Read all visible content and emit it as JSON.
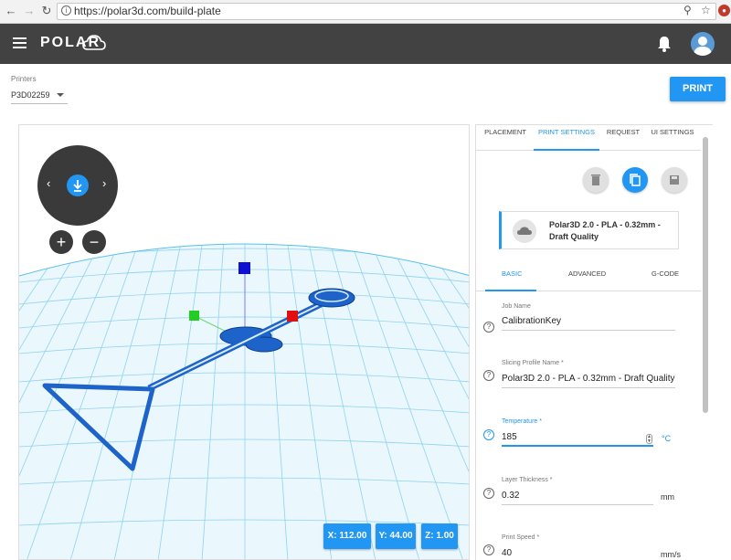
{
  "browser": {
    "url": "https://polar3d.com/build-plate",
    "back_icon": "arrow-left-icon",
    "forward_icon": "arrow-right-icon",
    "reload_icon": "reload-icon"
  },
  "header": {
    "logo_text": "POLAR",
    "bg_color": "#424242"
  },
  "printers": {
    "label": "Printers",
    "selected": "P3D02259"
  },
  "print_button": {
    "label": "PRINT",
    "color": "#2196f3"
  },
  "viewport": {
    "coords": {
      "x": "X: 112.00",
      "y": "Y: 44.00",
      "z": "Z: 1.00"
    },
    "zoom_in": "+",
    "zoom_out": "−"
  },
  "panel": {
    "tabs": [
      {
        "label": "PLACEMENT"
      },
      {
        "label": "PRINT SETTINGS"
      },
      {
        "label": "REQUEST"
      },
      {
        "label": "UI SETTINGS"
      }
    ],
    "profile_card": {
      "text": "Polar3D 2.0 - PLA - 0.32mm - Draft Quality"
    },
    "subtabs": [
      {
        "label": "BASIC"
      },
      {
        "label": "ADVANCED"
      },
      {
        "label": "G-CODE"
      }
    ],
    "fields": {
      "job_name": {
        "label": "Job Name",
        "value": "CalibrationKey"
      },
      "slicing_profile": {
        "label": "Slicing Profile Name *",
        "value": "Polar3D 2.0 - PLA - 0.32mm - Draft Quality"
      },
      "temperature": {
        "label": "Temperature *",
        "value": "185",
        "unit": "°C"
      },
      "layer_thickness": {
        "label": "Layer Thickness *",
        "value": "0.32",
        "unit": "mm"
      },
      "print_speed": {
        "label": "Print Speed *",
        "value": "40",
        "unit": "mm/s"
      }
    },
    "help_glyph": "?"
  }
}
